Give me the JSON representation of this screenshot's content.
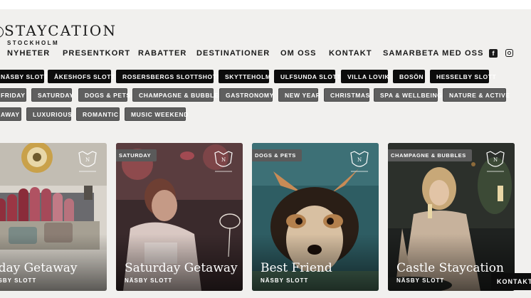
{
  "brand": {
    "name": "STAYCATION",
    "sub": "STOCKHOLM"
  },
  "nav": {
    "items": [
      "NYHETER",
      "PRESENTKORT",
      "RABATTER",
      "DESTINATIONER",
      "OM OSS",
      "KONTAKT",
      "SAMARBETA MED OSS"
    ]
  },
  "social": {
    "facebook": "f"
  },
  "destinations": [
    "NÄSBY SLOTT",
    "ÅKESHOFS SLOTT",
    "ROSERSBERGS SLOTTSHOTELL",
    "SKYTTEHOLM",
    "ULFSUNDA SLOTT",
    "VILLA LOVIK",
    "BOSÖN",
    "HESSELBY SLOTT"
  ],
  "themes_row1": [
    "FRIDAY",
    "SATURDAY",
    "DOGS & PETS",
    "CHAMPAGNE & BUBBLES",
    "GASTRONOMY",
    "NEW YEAR",
    "CHRISTMAS",
    "SPA & WELLBEING",
    "NATURE & ACTIVE"
  ],
  "themes_row2": [
    "AWAY",
    "LUXURIOUS",
    "ROMANTIC",
    "MUSIC WEEKEND"
  ],
  "cards": [
    {
      "title": "riday Getaway",
      "subtitle": "NÄSBY SLOTT",
      "tag": ""
    },
    {
      "title": "Saturday Getaway",
      "subtitle": "NÄSBY SLOTT",
      "tag": "SATURDAY"
    },
    {
      "title": "Best Friend",
      "subtitle": "NÄSBY SLOTT",
      "tag": "DOGS & PETS"
    },
    {
      "title": "Castle Staycation",
      "subtitle": "NÄSBY SLOTT",
      "tag": "CHAMPAGNE & BUBBLES"
    }
  ],
  "kontakt_button": "KONTAKTA"
}
